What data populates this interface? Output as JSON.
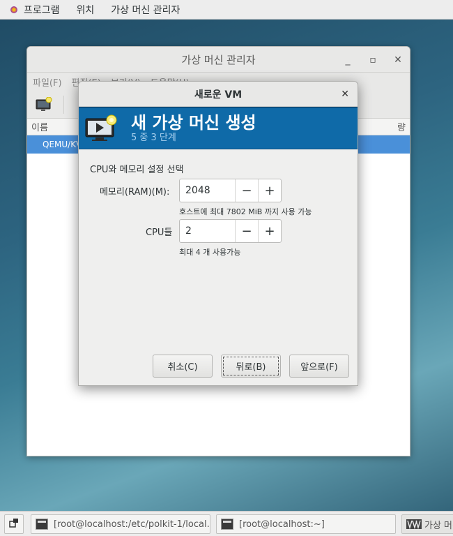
{
  "top_panel": {
    "applications": "프로그램",
    "places": "위치",
    "active_app": "가상 머신 관리자"
  },
  "main_window": {
    "title": "가상 머신 관리자",
    "menu": [
      "파일(F)",
      "편집(E)",
      "보기(V)",
      "도움말(H)"
    ],
    "column_name": "이름",
    "column_usage": "량",
    "row_label": "QEMU/KVM"
  },
  "dialog": {
    "title": "새로운 VM",
    "banner_title": "새 가상 머신 생성",
    "step": "5 중 3 단계",
    "section": "CPU와 메모리 설정 선택",
    "memory_label": "메모리(RAM)(M):",
    "memory_value": "2048",
    "memory_hint": "호스트에 최대 7802 MiB 까지 사용 가능",
    "cpu_label": "CPU들",
    "cpu_value": "2",
    "cpu_hint": "최대 4 개 사용가능",
    "minus": "−",
    "plus": "+",
    "cancel": "취소(C)",
    "back": "뒤로(B)",
    "forward": "앞으로(F)"
  },
  "taskbar": {
    "task1": "[root@localhost:/etc/polkit-1/local…",
    "task2": "[root@localhost:~]",
    "task3": "가상 머신 관리자"
  }
}
